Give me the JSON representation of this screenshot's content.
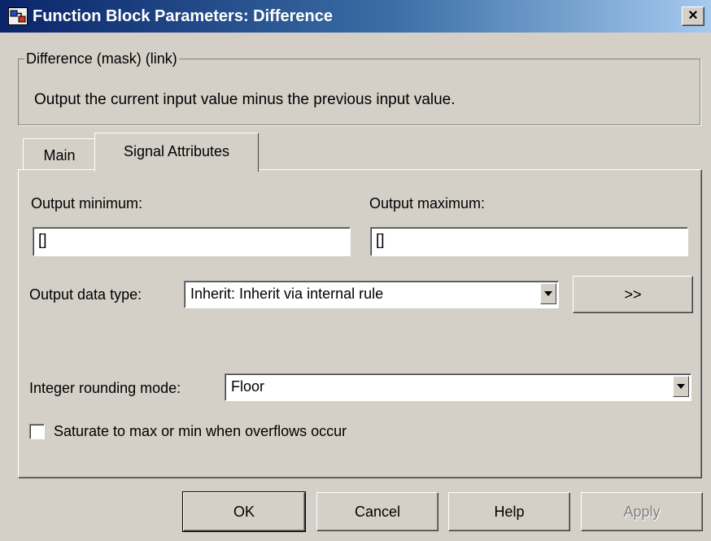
{
  "window": {
    "title": "Function Block Parameters: Difference",
    "close_glyph": "×"
  },
  "group": {
    "title": "Difference (mask) (link)",
    "description": "Output the current input value minus the previous input value."
  },
  "tabs": [
    {
      "label": "Main",
      "selected": false
    },
    {
      "label": "Signal Attributes",
      "selected": true
    }
  ],
  "fields": {
    "output_minimum": {
      "label": "Output minimum:",
      "value": "[]"
    },
    "output_maximum": {
      "label": "Output maximum:",
      "value": "[]"
    },
    "output_data_type": {
      "label": "Output data type:",
      "value": "Inherit: Inherit via internal rule",
      "expand_button": ">>"
    },
    "integer_rounding_mode": {
      "label": "Integer rounding mode:",
      "value": "Floor"
    },
    "saturate": {
      "label": "Saturate to max or min when overflows occur",
      "checked": false
    }
  },
  "buttons": {
    "ok": "OK",
    "cancel": "Cancel",
    "help": "Help",
    "apply": "Apply"
  },
  "icons": {
    "app": "simulink-block-icon",
    "close": "close-icon",
    "dropdown": "chevron-down-icon"
  },
  "colors": {
    "title_start": "#0a246a",
    "title_end": "#a6caf0",
    "face": "#d4d0c8",
    "disabled_text": "#808080"
  }
}
